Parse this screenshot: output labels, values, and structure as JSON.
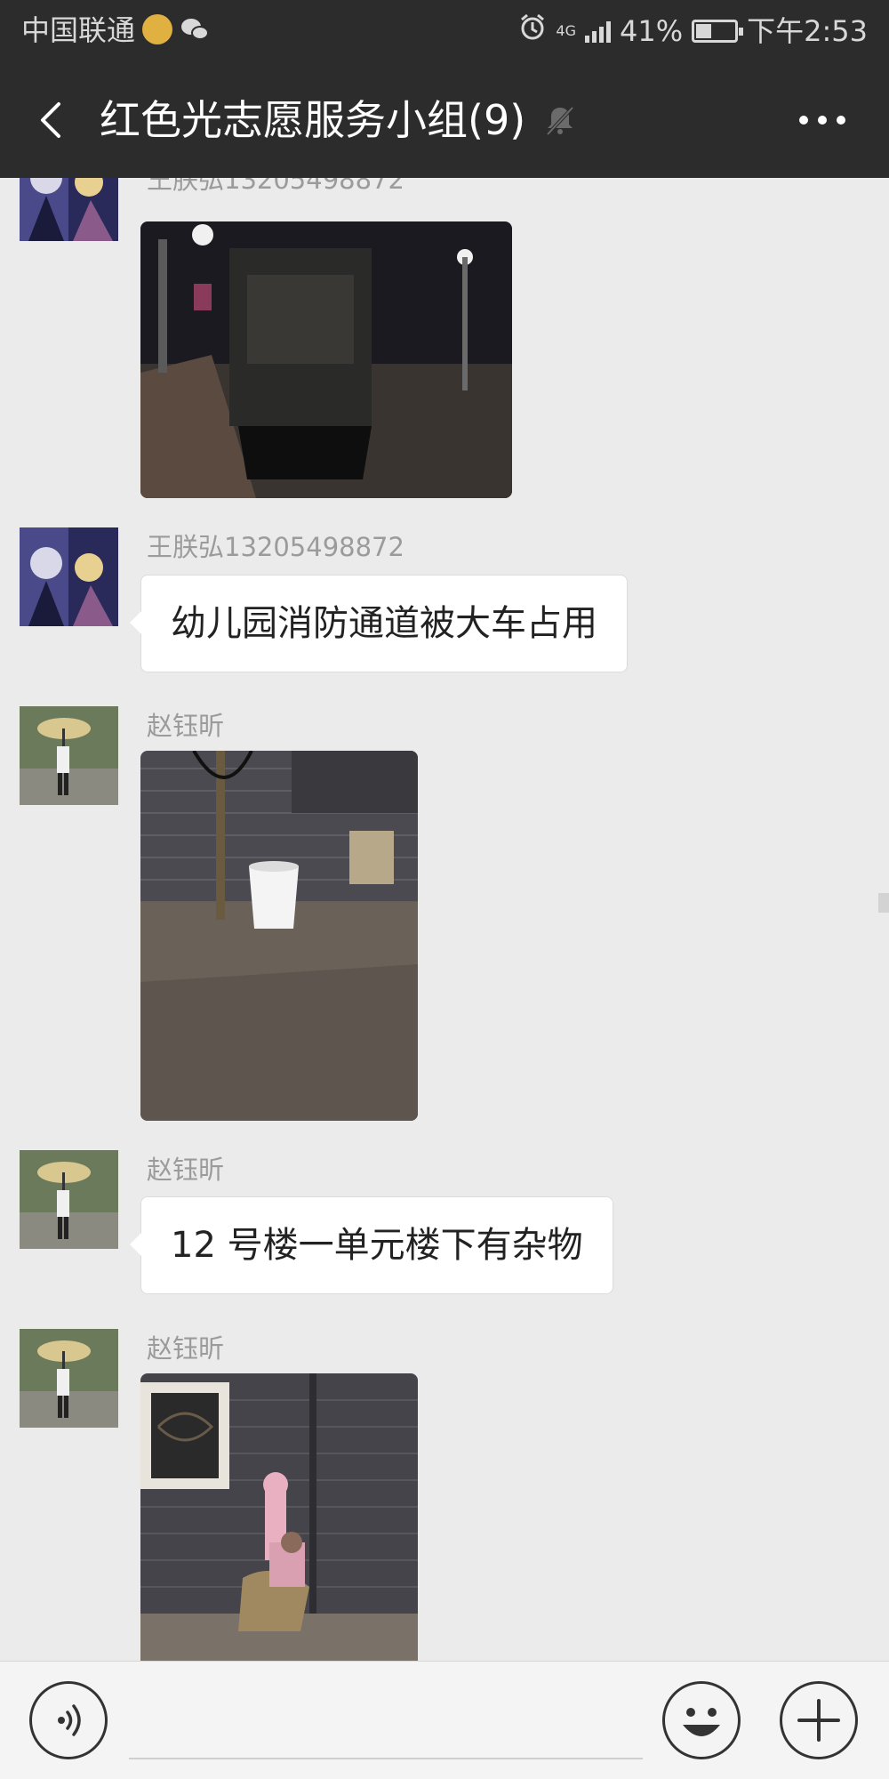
{
  "status_bar": {
    "carrier": "中国联通",
    "network": "4G",
    "battery": "41%",
    "battery_level": 0.41,
    "time": "下午2:53"
  },
  "header": {
    "back_icon": "chevron-left-icon",
    "title": "红色光志愿服务小组(9)",
    "mute_icon": "bell-off-icon",
    "more_icon": "more-dots-icon"
  },
  "messages": [
    {
      "sender": "王朕弘13205498872",
      "type": "image",
      "image_desc": "night street with parked truck"
    },
    {
      "sender": "王朕弘13205498872",
      "type": "text",
      "text": "幼儿园消防通道被大车占用"
    },
    {
      "sender": "赵钰昕",
      "type": "image",
      "image_desc": "brick wall with white bucket"
    },
    {
      "sender": "赵钰昕",
      "type": "text",
      "text": "12 号楼一单元楼下有杂物"
    },
    {
      "sender": "赵钰昕",
      "type": "image",
      "image_desc": "corner with pink toy horse"
    }
  ],
  "input_bar": {
    "voice_icon": "voice-icon",
    "emoji_icon": "smiley-icon",
    "plus_icon": "plus-icon"
  },
  "colors": {
    "header_bg": "#2c2c2c",
    "chat_bg": "#ebebeb",
    "bubble_bg": "#ffffff",
    "sender_text": "#9b9b9b"
  }
}
